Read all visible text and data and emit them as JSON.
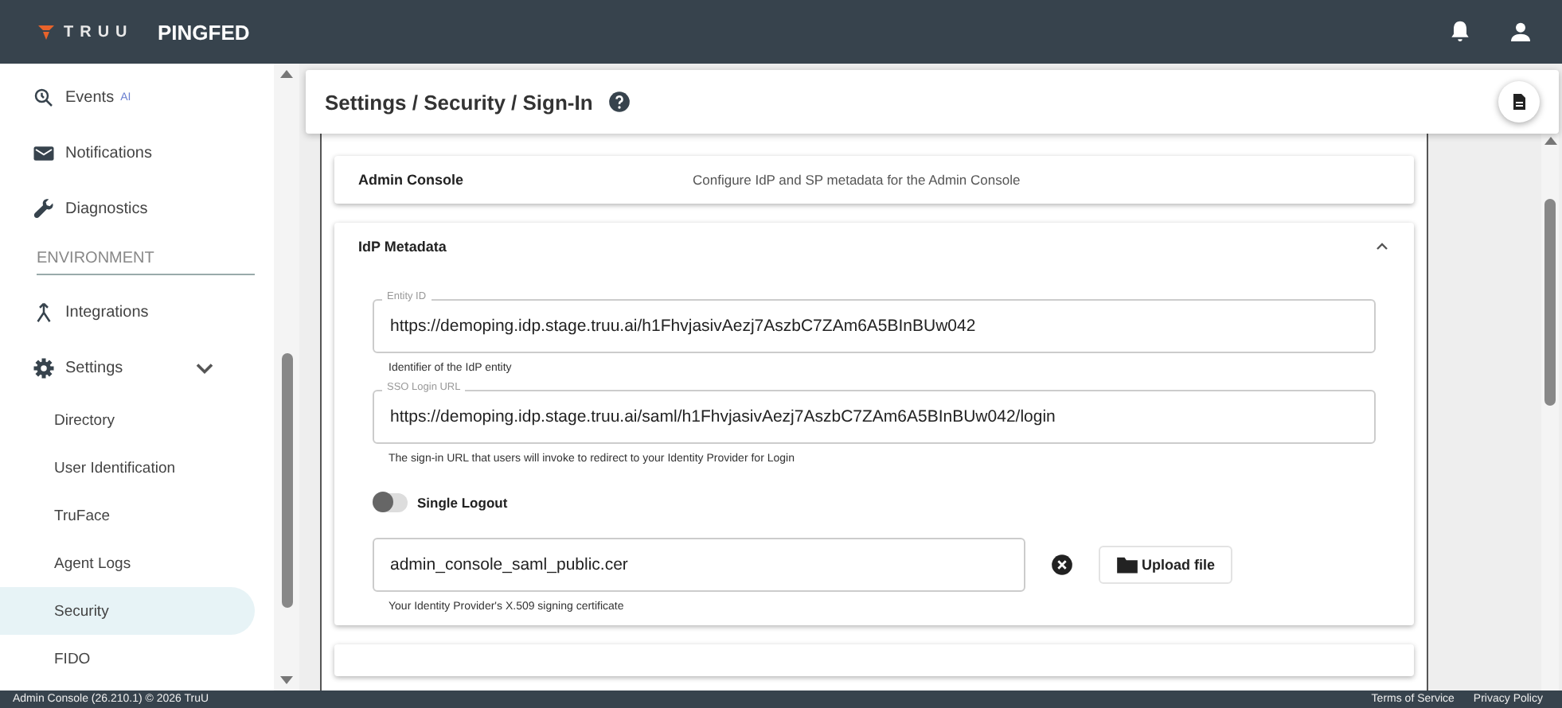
{
  "header": {
    "logo": "TRUU",
    "product": "PINGFED"
  },
  "sidebar": {
    "items": [
      {
        "kind": "item",
        "label": "Events",
        "badge": "AI",
        "selected": false
      },
      {
        "kind": "item",
        "label": "Notifications",
        "selected": false
      },
      {
        "kind": "item",
        "label": "Diagnostics",
        "selected": false
      },
      {
        "kind": "section",
        "label": "ENVIRONMENT"
      },
      {
        "kind": "item",
        "label": "Integrations",
        "selected": false
      },
      {
        "kind": "group",
        "label": "Settings",
        "expanded": true,
        "selected": false
      },
      {
        "kind": "sub",
        "label": "Directory",
        "selected": false
      },
      {
        "kind": "sub",
        "label": "User Identification",
        "selected": false
      },
      {
        "kind": "sub",
        "label": "TruFace",
        "selected": false
      },
      {
        "kind": "sub",
        "label": "Agent Logs",
        "selected": false
      },
      {
        "kind": "sub",
        "label": "Security",
        "selected": true
      },
      {
        "kind": "sub",
        "label": "FIDO",
        "selected": false
      }
    ]
  },
  "page": {
    "breadcrumb": "Settings / Security / Sign-In"
  },
  "panels": [
    {
      "title": "Admin Console",
      "description": "Configure IdP and SP metadata for the Admin Console",
      "expanded": false
    },
    {
      "title": "IdP Metadata",
      "expanded": true
    }
  ],
  "fields": [
    {
      "label": "Entity ID",
      "value": "https://demoping.idp.stage.truu.ai/h1FhvjasivAezj7AszbC7ZAm6A5BInBUw042",
      "helper": "Identifier of the IdP entity"
    },
    {
      "label": "SSO Login URL",
      "value": "https://demoping.idp.stage.truu.ai/saml/h1FhvjasivAezj7AszbC7ZAm6A5BInBUw042/login",
      "helper": "The sign-in URL that users will invoke to redirect to your Identity Provider for Login"
    }
  ],
  "single_logout": {
    "label": "Single Logout",
    "on": false
  },
  "certificate": {
    "value": "admin_console_saml_public.cer",
    "helper": "Your Identity Provider's X.509 signing certificate",
    "upload": "Upload file"
  },
  "footer": {
    "copyright": "Admin Console (26.210.1) © 2026 TruU",
    "links": [
      "Terms of Service",
      "Privacy Policy"
    ]
  }
}
